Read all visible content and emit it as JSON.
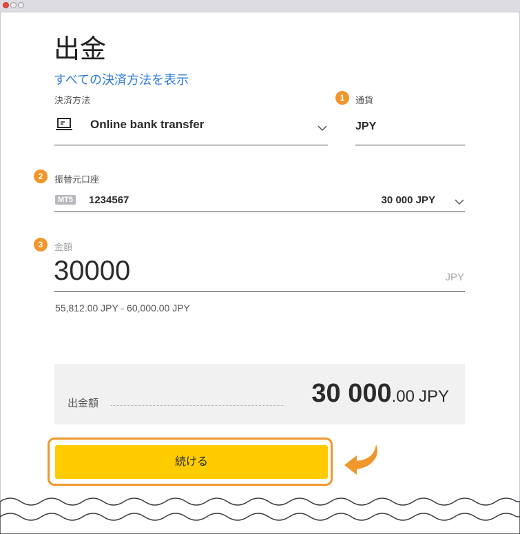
{
  "page": {
    "title": "出金",
    "show_all_link": "すべての決済方法を表示"
  },
  "payment_method": {
    "label": "決済方法",
    "value": "Online bank transfer",
    "icon": "laptop-icon"
  },
  "currency": {
    "step": "1",
    "label": "通貨",
    "value": "JPY"
  },
  "account": {
    "step": "2",
    "label": "振替元口座",
    "platform_badge": "MT5",
    "number": "1234567",
    "balance": "30 000 JPY"
  },
  "amount": {
    "step": "3",
    "label": "金額",
    "value": "30000",
    "unit": "JPY",
    "range": "55,812.00 JPY  -  60,000.00 JPY"
  },
  "summary": {
    "label": "出金額",
    "amount_int": "30 000",
    "amount_dec": ".00",
    "currency": "JPY"
  },
  "actions": {
    "continue_label": "続ける"
  },
  "colors": {
    "accent_orange": "#f0962a",
    "button_yellow": "#ffcc00",
    "link_blue": "#2f7bd6"
  }
}
